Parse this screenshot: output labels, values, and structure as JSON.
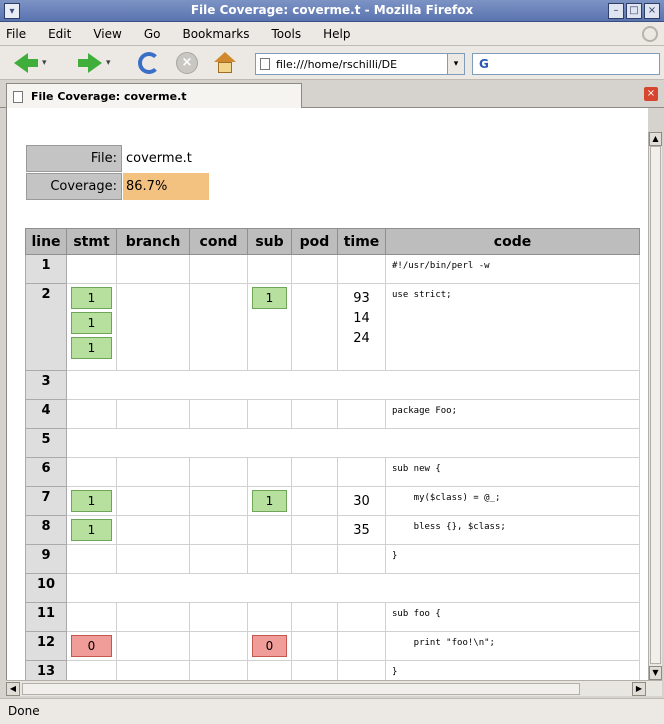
{
  "window": {
    "title": "File Coverage: coverme.t - Mozilla Firefox"
  },
  "menu": [
    "File",
    "Edit",
    "View",
    "Go",
    "Bookmarks",
    "Tools",
    "Help"
  ],
  "toolbar": {
    "url": "file:///home/rschilli/DE",
    "search_text": "G"
  },
  "tab": {
    "label": "File Coverage: coverme.t"
  },
  "summary": {
    "file_label": "File:",
    "file_value": "coverme.t",
    "coverage_label": "Coverage:",
    "coverage_value": "86.7%"
  },
  "table": {
    "headers": [
      "line",
      "stmt",
      "branch",
      "cond",
      "sub",
      "pod",
      "time",
      "code"
    ],
    "rows": [
      {
        "line": "1",
        "stmt": [],
        "sub": [],
        "time": [],
        "code": "#!/usr/bin/perl -w",
        "full": false
      },
      {
        "line": "2",
        "stmt": [
          "1",
          "1",
          "1"
        ],
        "sub": [
          "1"
        ],
        "time": [
          "93",
          "14",
          "24"
        ],
        "code": "use strict;",
        "full": false
      },
      {
        "line": "3",
        "stmt": [],
        "sub": [],
        "time": [],
        "code": "",
        "full": true
      },
      {
        "line": "4",
        "stmt": [],
        "sub": [],
        "time": [],
        "code": "package Foo;",
        "full": false
      },
      {
        "line": "5",
        "stmt": [],
        "sub": [],
        "time": [],
        "code": "",
        "full": true
      },
      {
        "line": "6",
        "stmt": [],
        "sub": [],
        "time": [],
        "code": "sub new {",
        "full": false
      },
      {
        "line": "7",
        "stmt": [
          "1"
        ],
        "sub": [
          "1"
        ],
        "time": [
          "30"
        ],
        "code": "    my($class) = @_;",
        "full": false
      },
      {
        "line": "8",
        "stmt": [
          "1"
        ],
        "sub": [],
        "time": [
          "35"
        ],
        "code": "    bless {}, $class;",
        "full": false
      },
      {
        "line": "9",
        "stmt": [],
        "sub": [],
        "time": [],
        "code": "}",
        "full": false
      },
      {
        "line": "10",
        "stmt": [],
        "sub": [],
        "time": [],
        "code": "",
        "full": true
      },
      {
        "line": "11",
        "stmt": [],
        "sub": [],
        "time": [],
        "code": "sub foo {",
        "full": false
      },
      {
        "line": "12",
        "stmt": [
          "0"
        ],
        "sub": [
          "0"
        ],
        "time": [],
        "code": "    print \"foo!\\n\";",
        "full": false
      },
      {
        "line": "13",
        "stmt": [],
        "sub": [],
        "time": [],
        "code": "}",
        "full": false
      }
    ]
  },
  "status": {
    "text": "Done"
  },
  "colors": {
    "covered": "#b7df9e",
    "uncovered": "#f09c98",
    "coverage_badge": "#f3c281",
    "header": "#bdbdbd"
  },
  "icons": [
    "back-arrow-icon",
    "forward-arrow-icon",
    "reload-icon",
    "stop-icon",
    "home-icon",
    "page-icon",
    "search-engine-icon",
    "close-tab-icon",
    "throbber-icon"
  ]
}
